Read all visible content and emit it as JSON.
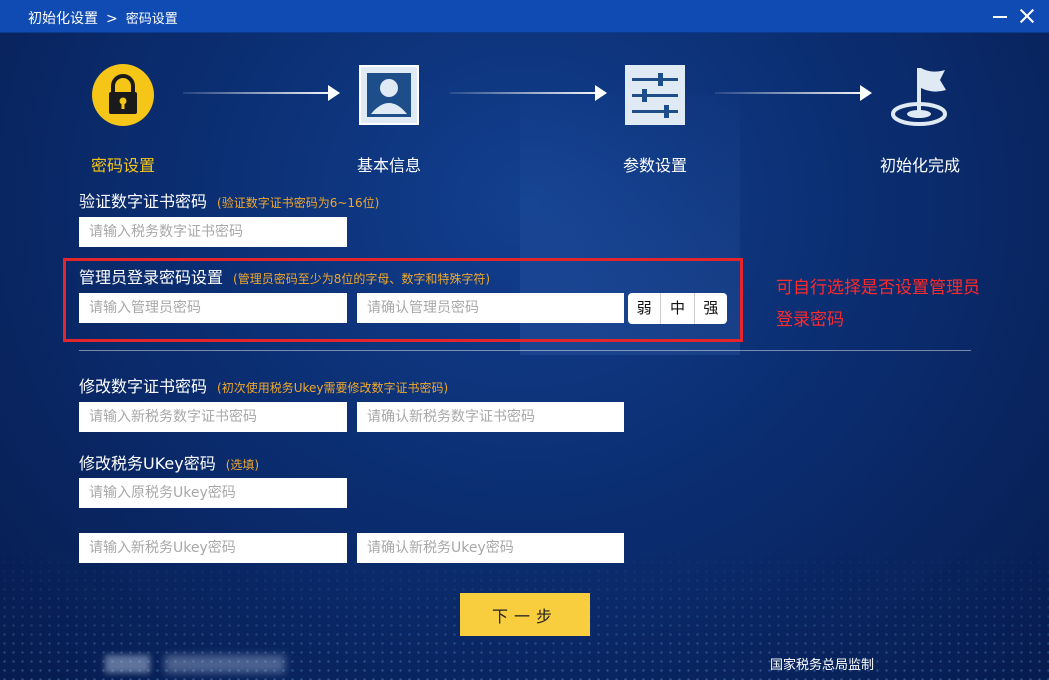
{
  "titlebar": {
    "breadcrumb_root": "初始化设置",
    "separator": ">",
    "breadcrumb_current": "密码设置"
  },
  "steps": [
    {
      "label": "密码设置",
      "icon": "lock-icon",
      "active": true
    },
    {
      "label": "基本信息",
      "icon": "id-card-icon",
      "active": false
    },
    {
      "label": "参数设置",
      "icon": "sliders-icon",
      "active": false
    },
    {
      "label": "初始化完成",
      "icon": "flag-icon",
      "active": false
    }
  ],
  "cert_verify": {
    "title": "验证数字证书密码",
    "hint": "(验证数字证书密码为6~16位)",
    "placeholder": "请输入税务数字证书密码",
    "value": ""
  },
  "admin_password": {
    "title": "管理员登录密码设置",
    "hint": "(管理员密码至少为8位的字母、数字和特殊字符)",
    "placeholder": "请输入管理员密码",
    "confirm_placeholder": "请确认管理员密码",
    "strength_levels": [
      "弱",
      "中",
      "强"
    ]
  },
  "annotation": "可自行选择是否设置管理员登录密码",
  "cert_change": {
    "title": "修改数字证书密码",
    "hint": "(初次使用税务Ukey需要修改数字证书密码)",
    "new_placeholder": "请输入新税务数字证书密码",
    "confirm_placeholder": "请确认新税务数字证书密码"
  },
  "ukey_change": {
    "title": "修改税务UKey密码",
    "hint": "(选填)",
    "old_placeholder": "请输入原税务Ukey密码",
    "new_placeholder": "请输入新税务Ukey密码",
    "confirm_placeholder": "请确认新税务Ukey密码"
  },
  "next_button": "下一步",
  "footer": "国家税务总局监制",
  "colors": {
    "titlebar": "#0f4bb3",
    "accent_yellow": "#f5c518",
    "hint_orange": "#f0a82c",
    "annotation_red": "#e3262b",
    "button_yellow": "#f8ce3e"
  }
}
